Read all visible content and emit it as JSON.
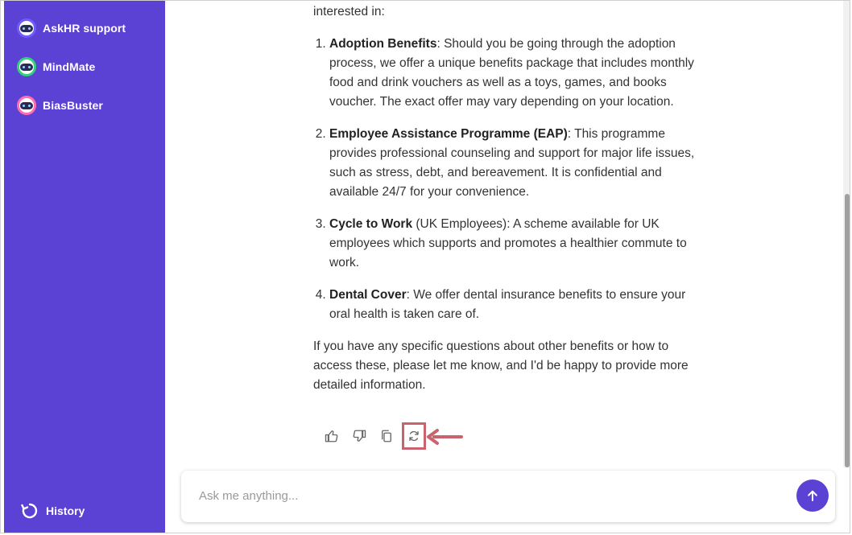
{
  "sidebar": {
    "bots": [
      {
        "label": "AskHR support",
        "ring": "#6f5cff"
      },
      {
        "label": "MindMate",
        "ring": "#33d17a"
      },
      {
        "label": "BiasBuster",
        "ring": "#ff6fb0"
      }
    ],
    "history_label": "History"
  },
  "message": {
    "intro": "interested in:",
    "items": [
      {
        "title": "Adoption Benefits",
        "text": ": Should you be going through the adoption process, we offer a unique benefits package that includes monthly food and drink vouchers as well as a toys, games, and books voucher. The exact offer may vary depending on your location."
      },
      {
        "title": "Employee Assistance Programme (EAP)",
        "text": ": This programme provides professional counseling and support for major life issues, such as stress, debt, and bereavement. It is confidential and available 24/7 for your convenience."
      },
      {
        "title": "Cycle to Work",
        "text": " (UK Employees): A scheme available for UK employees which supports and promotes a healthier commute to work."
      },
      {
        "title": "Dental Cover",
        "text": ": We offer dental insurance benefits to ensure your oral health is taken care of."
      }
    ],
    "closing": "If you have any specific questions about other benefits or how to access these, please let me know, and I'd be happy to provide more detailed information."
  },
  "actions": {
    "icons": [
      "thumbs-up-icon",
      "thumbs-down-icon",
      "copy-icon",
      "regenerate-icon"
    ],
    "highlight_color": "#c9636e"
  },
  "input": {
    "placeholder": "Ask me anything...",
    "value": ""
  },
  "colors": {
    "sidebar": "#5b41d4",
    "accent": "#5b41d4"
  }
}
